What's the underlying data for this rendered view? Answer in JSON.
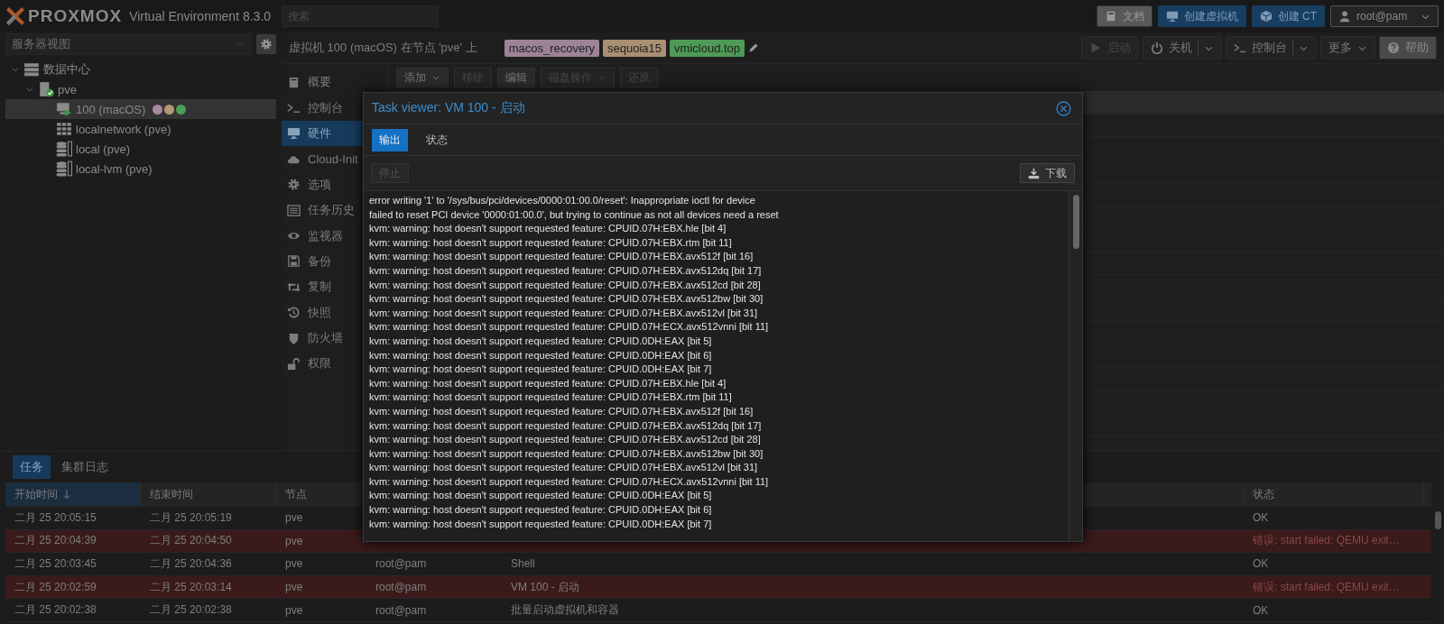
{
  "header": {
    "logo": "PROXMOX",
    "version": "Virtual Environment 8.3.0",
    "search": {
      "placeholder": "搜索"
    },
    "buttons": [
      {
        "label": "文档",
        "kind": "docs"
      },
      {
        "label": "创建虚拟机",
        "kind": "create-vm"
      },
      {
        "label": "创建 CT",
        "kind": "create-ct"
      },
      {
        "label": "root@pam",
        "kind": "user"
      }
    ]
  },
  "sidebar": {
    "view_selector": "服务器视图",
    "tree": [
      {
        "label": "数据中心",
        "kind": "datacenter",
        "expanded": true,
        "selected": false,
        "children": [
          {
            "label": "pve",
            "kind": "node",
            "expanded": true,
            "selected": false,
            "children": [
              {
                "label": "100 (macOS)",
                "kind": "vm",
                "selected": true,
                "tags": [
                  {
                    "color": "#a48a9d"
                  },
                  {
                    "color": "#b39876"
                  },
                  {
                    "color": "#4e9e55"
                  }
                ]
              },
              {
                "label": "localnetwork (pve)",
                "kind": "network",
                "selected": false
              },
              {
                "label": "local (pve)",
                "kind": "storage",
                "selected": false
              },
              {
                "label": "local-lvm (pve)",
                "kind": "storage",
                "selected": false
              }
            ]
          }
        ]
      }
    ]
  },
  "vm_header": {
    "title": "虚拟机 100 (macOS) 在节点 'pve' 上",
    "tags": [
      {
        "label": "macos_recovery",
        "color": "#9c8496"
      },
      {
        "label": "sequoia15",
        "color": "#a89070"
      },
      {
        "label": "vmicloud.top",
        "color": "#4e9a56"
      }
    ],
    "buttons": [
      {
        "label": "启动",
        "kind": "start",
        "disabled": true
      },
      {
        "label": "关机",
        "kind": "shutdown",
        "disabled": false
      },
      {
        "label": "控制台",
        "kind": "console",
        "disabled": false
      },
      {
        "label": "更多",
        "kind": "more",
        "disabled": false
      },
      {
        "label": "帮助",
        "kind": "help",
        "disabled": false
      }
    ]
  },
  "vm_menu": [
    {
      "label": "概要",
      "kind": "summary",
      "selected": false
    },
    {
      "label": "控制台",
      "kind": "console",
      "selected": false
    },
    {
      "label": "硬件",
      "kind": "hardware",
      "selected": true
    },
    {
      "label": "Cloud-Init",
      "kind": "cloud",
      "selected": false
    },
    {
      "label": "选项",
      "kind": "options",
      "selected": false
    },
    {
      "label": "任务历史",
      "kind": "tasks",
      "selected": false
    },
    {
      "label": "监视器",
      "kind": "monitor",
      "selected": false
    },
    {
      "label": "备份",
      "kind": "backup",
      "selected": false
    },
    {
      "label": "复制",
      "kind": "replication",
      "selected": false
    },
    {
      "label": "快照",
      "kind": "snapshot",
      "selected": false
    },
    {
      "label": "防火墙",
      "kind": "firewall",
      "selected": false
    },
    {
      "label": "权限",
      "kind": "permissions",
      "selected": false
    }
  ],
  "hardware_toolbar": [
    {
      "label": "添加",
      "disabled": false,
      "menu": true
    },
    {
      "label": "移除",
      "disabled": true,
      "menu": false
    },
    {
      "label": "编辑",
      "disabled": false,
      "menu": false
    },
    {
      "label": "磁盘操作",
      "disabled": true,
      "menu": true
    },
    {
      "label": "还原",
      "disabled": true,
      "menu": false
    }
  ],
  "task_viewer": {
    "title": "Task viewer: VM 100 - 启动",
    "tabs": [
      {
        "label": "输出",
        "selected": true
      },
      {
        "label": "状态",
        "selected": false
      }
    ],
    "stop_button": {
      "label": "停止",
      "disabled": true
    },
    "download_button": {
      "label": "下载"
    },
    "log": [
      "error writing '1' to '/sys/bus/pci/devices/0000:01:00.0/reset': Inappropriate ioctl for device",
      "failed to reset PCI device '0000:01:00.0', but trying to continue as not all devices need a reset",
      "kvm: warning: host doesn't support requested feature: CPUID.07H:EBX.hle [bit 4]",
      "kvm: warning: host doesn't support requested feature: CPUID.07H:EBX.rtm [bit 11]",
      "kvm: warning: host doesn't support requested feature: CPUID.07H:EBX.avx512f [bit 16]",
      "kvm: warning: host doesn't support requested feature: CPUID.07H:EBX.avx512dq [bit 17]",
      "kvm: warning: host doesn't support requested feature: CPUID.07H:EBX.avx512cd [bit 28]",
      "kvm: warning: host doesn't support requested feature: CPUID.07H:EBX.avx512bw [bit 30]",
      "kvm: warning: host doesn't support requested feature: CPUID.07H:EBX.avx512vl [bit 31]",
      "kvm: warning: host doesn't support requested feature: CPUID.07H:ECX.avx512vnni [bit 11]",
      "kvm: warning: host doesn't support requested feature: CPUID.0DH:EAX [bit 5]",
      "kvm: warning: host doesn't support requested feature: CPUID.0DH:EAX [bit 6]",
      "kvm: warning: host doesn't support requested feature: CPUID.0DH:EAX [bit 7]",
      "kvm: warning: host doesn't support requested feature: CPUID.07H:EBX.hle [bit 4]",
      "kvm: warning: host doesn't support requested feature: CPUID.07H:EBX.rtm [bit 11]",
      "kvm: warning: host doesn't support requested feature: CPUID.07H:EBX.avx512f [bit 16]",
      "kvm: warning: host doesn't support requested feature: CPUID.07H:EBX.avx512dq [bit 17]",
      "kvm: warning: host doesn't support requested feature: CPUID.07H:EBX.avx512cd [bit 28]",
      "kvm: warning: host doesn't support requested feature: CPUID.07H:EBX.avx512bw [bit 30]",
      "kvm: warning: host doesn't support requested feature: CPUID.07H:EBX.avx512vl [bit 31]",
      "kvm: warning: host doesn't support requested feature: CPUID.07H:ECX.avx512vnni [bit 11]",
      "kvm: warning: host doesn't support requested feature: CPUID.0DH:EAX [bit 5]",
      "kvm: warning: host doesn't support requested feature: CPUID.0DH:EAX [bit 6]",
      "kvm: warning: host doesn't support requested feature: CPUID.0DH:EAX [bit 7]"
    ]
  },
  "bottom_panel": {
    "tabs": [
      {
        "label": "任务",
        "selected": true
      },
      {
        "label": "集群日志",
        "selected": false
      }
    ],
    "columns": [
      {
        "label": "开始时间",
        "sorted": true
      },
      {
        "label": "结束时间",
        "sorted": false
      },
      {
        "label": "节点",
        "sorted": false
      },
      {
        "label": "状态",
        "sorted": false
      }
    ],
    "rows": [
      {
        "start": "二月 25 20:05:15",
        "end": "二月 25 20:05:19",
        "node": "pve",
        "status": "OK",
        "kind": "ok"
      },
      {
        "start": "二月 25 20:04:39",
        "end": "二月 25 20:04:50",
        "node": "pve",
        "status": "错误: start failed: QEMU exit…",
        "kind": "error"
      },
      {
        "start": "二月 25 20:03:45",
        "end": "二月 25 20:04:36",
        "node": "pve",
        "user": "root@pam",
        "description": "Shell",
        "status": "OK",
        "kind": "ok"
      },
      {
        "start": "二月 25 20:02:59",
        "end": "二月 25 20:03:14",
        "node": "pve",
        "user": "root@pam",
        "description": "VM 100 - 启动",
        "status": "错误: start failed: QEMU exit…",
        "kind": "error"
      },
      {
        "start": "二月 25 20:02:38",
        "end": "二月 25 20:02:38",
        "node": "pve",
        "user": "root@pam",
        "description": "批量启动虚拟机和容器",
        "status": "OK",
        "kind": "ok"
      }
    ]
  }
}
